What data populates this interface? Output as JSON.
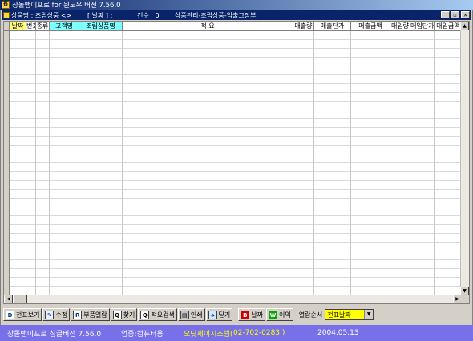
{
  "app": {
    "title": "장돌뱅이프로 for 윈도우 버전 7.56.0",
    "icon_text": "長"
  },
  "mdi": {
    "product_label": "상품명 : 조립상품 <>",
    "date_label": "[ 날짜 ] :",
    "count_label": "건수 : 0",
    "window_name": "상품관리-조립상품-입출고장부",
    "buttons": [
      "_",
      "▫",
      "×"
    ]
  },
  "grid": {
    "columns": [
      {
        "label": "날짜",
        "style": "y"
      },
      {
        "label": "번호",
        "style": "w"
      },
      {
        "label": "종류",
        "style": "w"
      },
      {
        "label": "고객명",
        "style": "c"
      },
      {
        "label": "조립상품명",
        "style": "c"
      },
      {
        "label": "적     요",
        "style": "w"
      },
      {
        "label": "매출량",
        "style": "w"
      },
      {
        "label": "매출단가",
        "style": "w"
      },
      {
        "label": "매출금액",
        "style": "w"
      },
      {
        "label": "매입량",
        "style": "w"
      },
      {
        "label": "매입단가",
        "style": "w"
      },
      {
        "label": "매입금액",
        "style": "w"
      }
    ],
    "rows": []
  },
  "toolbar": {
    "buttons": [
      {
        "icon": "D",
        "label": "전표보기",
        "icon_name": "document-icon",
        "cls": "doc"
      },
      {
        "icon": "✎",
        "label": "수정",
        "icon_name": "edit-icon",
        "cls": "pen"
      },
      {
        "icon": "R",
        "label": "부품열람",
        "icon_name": "parts-icon",
        "cls": "doc"
      },
      {
        "icon": "Q",
        "label": "찾기",
        "icon_name": "find-icon",
        "cls": "find"
      },
      {
        "icon": "Q",
        "label": "적요검색",
        "icon_name": "memo-search-icon",
        "cls": "find"
      },
      {
        "icon": "▤",
        "label": "인쇄",
        "icon_name": "printer-icon",
        "cls": "print"
      },
      {
        "icon": "➜",
        "label": "닫기",
        "icon_name": "close-door-icon",
        "cls": "close"
      },
      {
        "icon": "B",
        "label": "날짜",
        "icon_name": "date-icon",
        "cls": "date"
      },
      {
        "icon": "W",
        "label": "이익",
        "icon_name": "profit-icon",
        "cls": "w"
      }
    ],
    "sort_label": "열람순서",
    "sort_value": "전표날짜"
  },
  "status": {
    "version": "장돌뱅이프로 싱글버전 7.56.0",
    "business": "업종:컴퓨터용",
    "company": "오딧세이시스템(",
    "phone": "02-702-0283 )",
    "date": "2004.05.13"
  }
}
